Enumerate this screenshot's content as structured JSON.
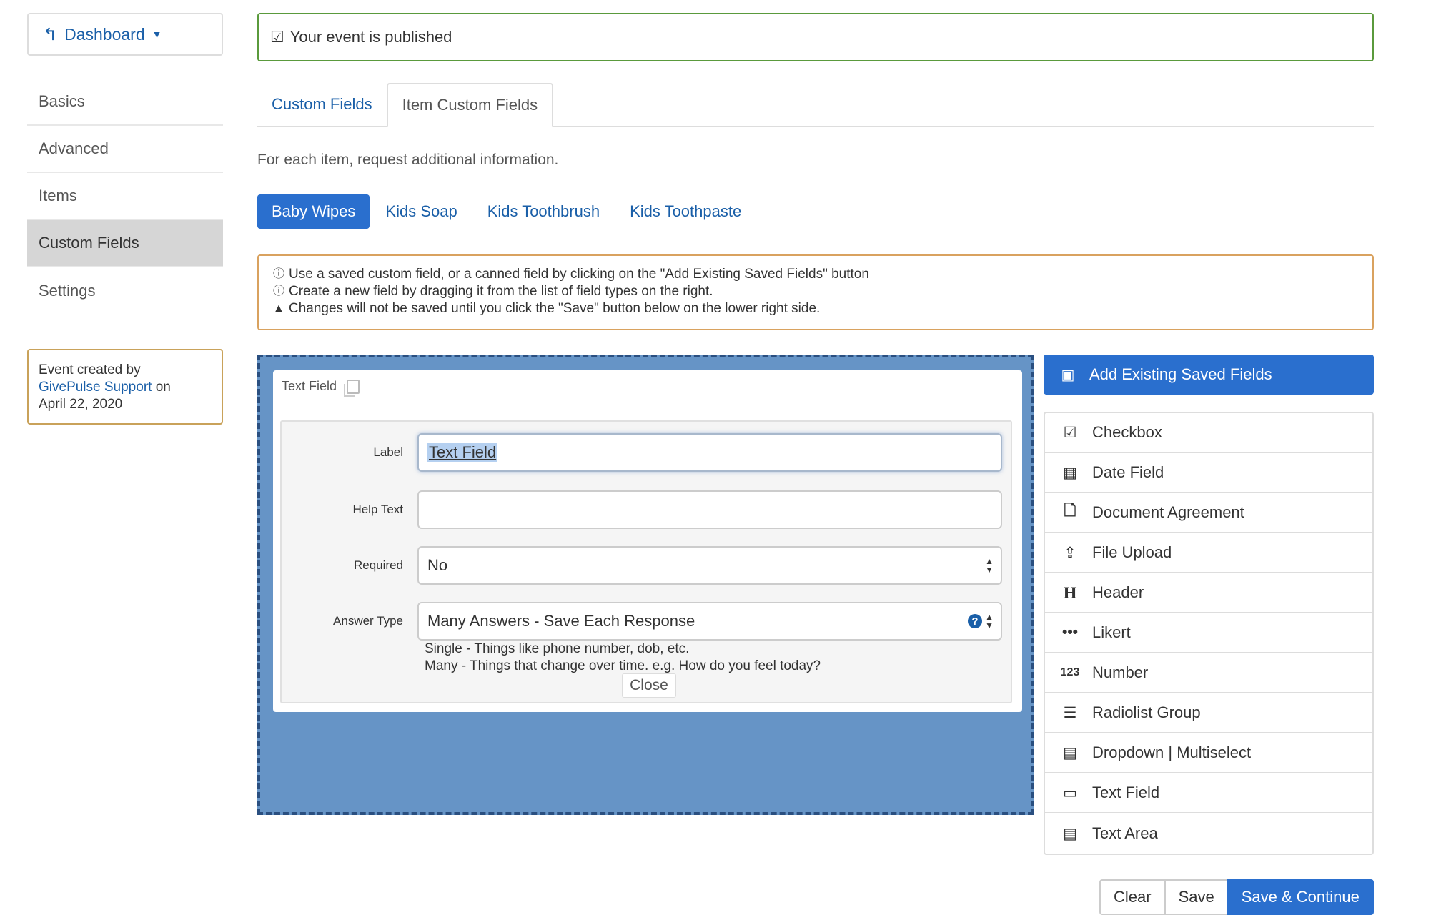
{
  "sidebar": {
    "dashboard_label": "Dashboard",
    "items": [
      {
        "label": "Basics"
      },
      {
        "label": "Advanced"
      },
      {
        "label": "Items"
      },
      {
        "label": "Custom Fields",
        "active": true
      },
      {
        "label": "Settings"
      }
    ],
    "created": {
      "prefix": "Event created by",
      "link": "GivePulse Support",
      "suffix": " on",
      "date": "April 22, 2020"
    }
  },
  "alert": {
    "text": "Your event is published"
  },
  "tabs": [
    {
      "label": "Custom Fields"
    },
    {
      "label": "Item Custom Fields",
      "active": true
    }
  ],
  "intro_text": "For each item, request additional information.",
  "items": [
    {
      "label": "Baby Wipes",
      "active": true
    },
    {
      "label": "Kids Soap"
    },
    {
      "label": "Kids Toothbrush"
    },
    {
      "label": "Kids Toothpaste"
    }
  ],
  "info": {
    "line1": "Use a saved custom field, or a canned field by clicking on the \"Add Existing Saved Fields\" button",
    "line2": "Create a new field by dragging it from the list of field types on the right.",
    "line3": "Changes will not be saved until you click the \"Save\" button below on the lower right side."
  },
  "field_card": {
    "title": "Text Field",
    "label_label": "Label",
    "label_value": "Text Field",
    "help_label": "Help Text",
    "help_value": "",
    "required_label": "Required",
    "required_value": "No",
    "answer_label": "Answer Type",
    "answer_value": "Many Answers - Save Each Response",
    "answer_help1": "Single - Things like phone number, dob, etc.",
    "answer_help2": "Many - Things that change over time. e.g. How do you feel today?",
    "close_label": "Close"
  },
  "right_panel": {
    "add_existing_label": "Add Existing Saved Fields",
    "field_types": [
      {
        "label": "Checkbox",
        "icon": "checkbox-icon"
      },
      {
        "label": "Date Field",
        "icon": "calendar-icon"
      },
      {
        "label": "Document Agreement",
        "icon": "document-icon"
      },
      {
        "label": "File Upload",
        "icon": "upload-icon"
      },
      {
        "label": "Header",
        "icon": "header-icon"
      },
      {
        "label": "Likert",
        "icon": "ellipsis-icon"
      },
      {
        "label": "Number",
        "icon": "number-icon"
      },
      {
        "label": "Radiolist Group",
        "icon": "list-icon"
      },
      {
        "label": "Dropdown | Multiselect",
        "icon": "dropdown-icon"
      },
      {
        "label": "Text Field",
        "icon": "textfield-icon"
      },
      {
        "label": "Text Area",
        "icon": "textarea-icon"
      }
    ]
  },
  "buttons": {
    "clear": "Clear",
    "save": "Save",
    "save_continue": "Save & Continue"
  }
}
